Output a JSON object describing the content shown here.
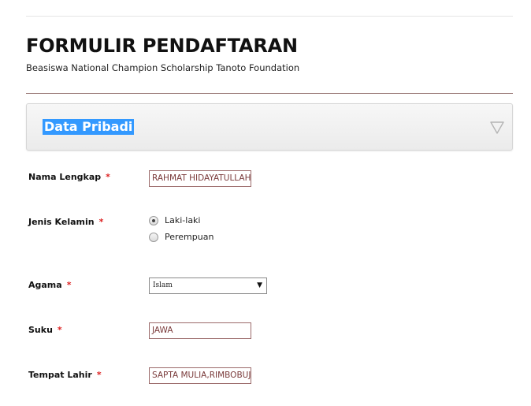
{
  "form": {
    "title": "FORMULIR PENDAFTARAN",
    "subtitle": "Beasiswa National Champion Scholarship Tanoto Foundation"
  },
  "section": {
    "title": "Data Pribadi",
    "toggle_icon": "triangle-down-icon"
  },
  "required_marker": "*",
  "fields": {
    "nama_lengkap": {
      "label": "Nama Lengkap",
      "value": "RAHMAT HIDAYATULLAH"
    },
    "jenis_kelamin": {
      "label": "Jenis Kelamin",
      "options": [
        {
          "label": "Laki-laki",
          "checked": true
        },
        {
          "label": "Perempuan",
          "checked": false
        }
      ]
    },
    "agama": {
      "label": "Agama",
      "selected": "Islam"
    },
    "suku": {
      "label": "Suku",
      "value": "JAWA"
    },
    "tempat_lahir": {
      "label": "Tempat Lahir",
      "value": "SAPTA MULIA,RIMBOBUJANG"
    }
  },
  "colors": {
    "accent_highlight": "#3399ff",
    "required": "#dd2222",
    "input_border": "#9b6a6a",
    "input_text": "#7a3a3a"
  }
}
